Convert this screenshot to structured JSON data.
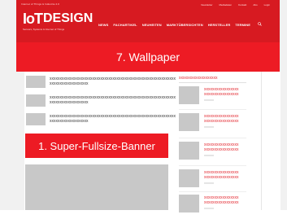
{
  "header": {
    "topbar_left": "Internet of Things & Industrie 4.0",
    "topbar_right": [
      "Newsletter",
      "Mediadaten",
      "Kontakt",
      "Abo",
      "Login"
    ],
    "logo_mark": "IoT",
    "logo_text": "DESIGN",
    "logo_subtitle": "Sensors, Systems & Internet of Things",
    "nav": [
      "NEWS",
      "FACHARTIKEL",
      "NEUHEITEN",
      "MARKTÜBERSICHTEN",
      "HERSTELLER",
      "TERMINE"
    ]
  },
  "wallpaper": {
    "label": "7. Wallpaper"
  },
  "articles": [
    {
      "text": "xxxxxxxxxxxxxxxxxxxxxxxxxxxxxxxxxxxxxxxxxxxxxxxxxxxxxxxxxxxxxxxxxxxxxxxxxxxxxxxxx"
    },
    {
      "text": "xxxxxxxxxxxxxxxxxxxxxxxxxxxxxxxxxxxxxxxxxxxxxxxxxxxxxxxxxxxxxxxxxxxxxxxxxxxxxxxxx"
    },
    {
      "text": "xxxxxxxxxxxxxxxxxxxxxxxxxxxxxxxxxxxxxxxxxxxxxxxxxxxxxxxxxxxxxxxxxxxxxxxxxxxxxxxxx"
    }
  ],
  "banner": {
    "label": "1. Super-Fullsize-Banner"
  },
  "sidebar": {
    "heading": "xxxxxxxxxxxxxxxxxxx",
    "items": [
      {
        "line1": "xxxxxxxxxxxxxxxxx",
        "line2": "xxxxxxxxxxxxxxxxx",
        "line3": "xxxxxx"
      },
      {
        "line1": "xxxxxxxxxxxxxxxxx",
        "line2": "xxxxxxxxxxxxxxxxx",
        "line3": "xxxxxx"
      },
      {
        "line1": "xxxxxxxxxxxxxxxxx",
        "line2": "xxxxxxxxxxxxxxxxx",
        "line3": "xxxxxx"
      },
      {
        "line1": "xxxxxxxxxxxxxxxxx",
        "line2": "xxxxxxxxxxxxxxxxx",
        "line3": "xxxxxx"
      },
      {
        "line1": "xxxxxxxxxxxxxxxxx",
        "line2": "xxxxxxxxxxxxxxxxx",
        "line3": "xxxxxx"
      }
    ]
  },
  "colors": {
    "brand_red": "#d71a21",
    "banner_red": "#ed1b24",
    "placeholder_gray": "#c8c8c8"
  }
}
